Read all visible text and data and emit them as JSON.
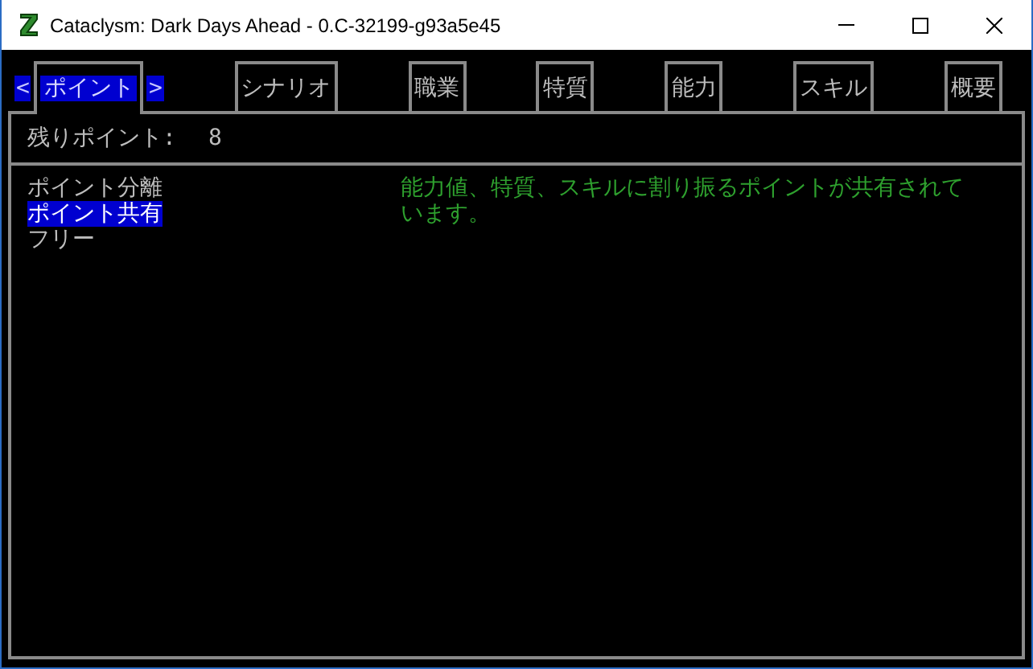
{
  "window": {
    "title": "Cataclysm: Dark Days Ahead - 0.C-32199-g93a5e45"
  },
  "tab_arrows": {
    "left": "<",
    "right": ">"
  },
  "tabs": [
    {
      "label": "ポイント",
      "selected": true
    },
    {
      "label": "シナリオ",
      "selected": false
    },
    {
      "label": "職業",
      "selected": false
    },
    {
      "label": "特質",
      "selected": false
    },
    {
      "label": "能力",
      "selected": false
    },
    {
      "label": "スキル",
      "selected": false
    },
    {
      "label": "概要",
      "selected": false
    }
  ],
  "points": {
    "label": "残りポイント:",
    "value": "8"
  },
  "options": [
    {
      "label": "ポイント分離",
      "selected": false
    },
    {
      "label": "ポイント共有",
      "selected": true
    },
    {
      "label": "フリー",
      "selected": false
    }
  ],
  "description": "能力値、特質、スキルに割り振るポイントが共有されています。"
}
